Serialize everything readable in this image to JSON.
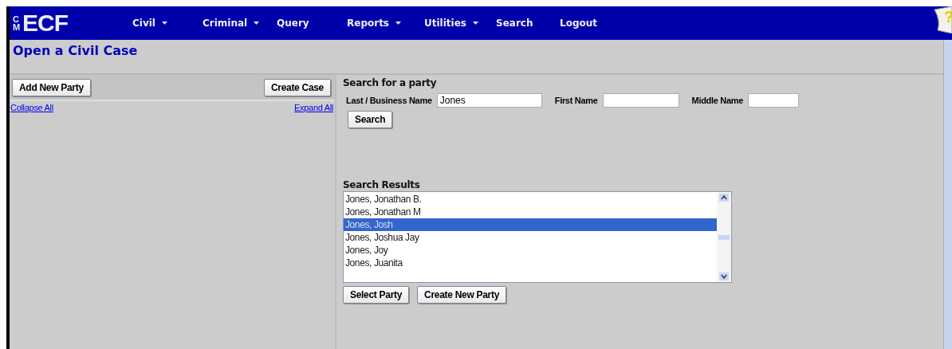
{
  "logo": {
    "small": "CM",
    "large": "ECF"
  },
  "menu": [
    {
      "label": "Civil",
      "has_menu": true
    },
    {
      "label": "Criminal",
      "has_menu": true
    },
    {
      "label": "Query",
      "has_menu": false
    },
    {
      "label": "Reports",
      "has_menu": true
    },
    {
      "label": "Utilities",
      "has_menu": true
    },
    {
      "label": "Search",
      "has_menu": false
    },
    {
      "label": "Logout",
      "has_menu": false
    }
  ],
  "help_icon": "?",
  "page_title": "Open a Civil Case",
  "left_panel": {
    "buttons": [
      "Add New Party",
      "Create Case"
    ],
    "links": [
      "Collapse All",
      "Expand All"
    ]
  },
  "search": {
    "heading": "Search for a party",
    "fields": [
      {
        "label": "Last / Business Name",
        "value": "Jones"
      },
      {
        "label": "First Name"
      },
      {
        "label": "Middle Name"
      }
    ],
    "button": "Search"
  },
  "results": {
    "heading": "Search Results",
    "items": [
      {
        "label": "Jones, Jonathan B.",
        "selected": false
      },
      {
        "label": "Jones, Jonathan M",
        "selected": false
      },
      {
        "label": "Jones, Josh",
        "selected": true
      },
      {
        "label": "Jones, Joshua Jay",
        "selected": false
      },
      {
        "label": "Jones, Joy",
        "selected": false
      },
      {
        "label": "Jones, Juanita",
        "selected": false
      }
    ],
    "buttons": [
      "Select Party",
      "Create New Party"
    ]
  }
}
